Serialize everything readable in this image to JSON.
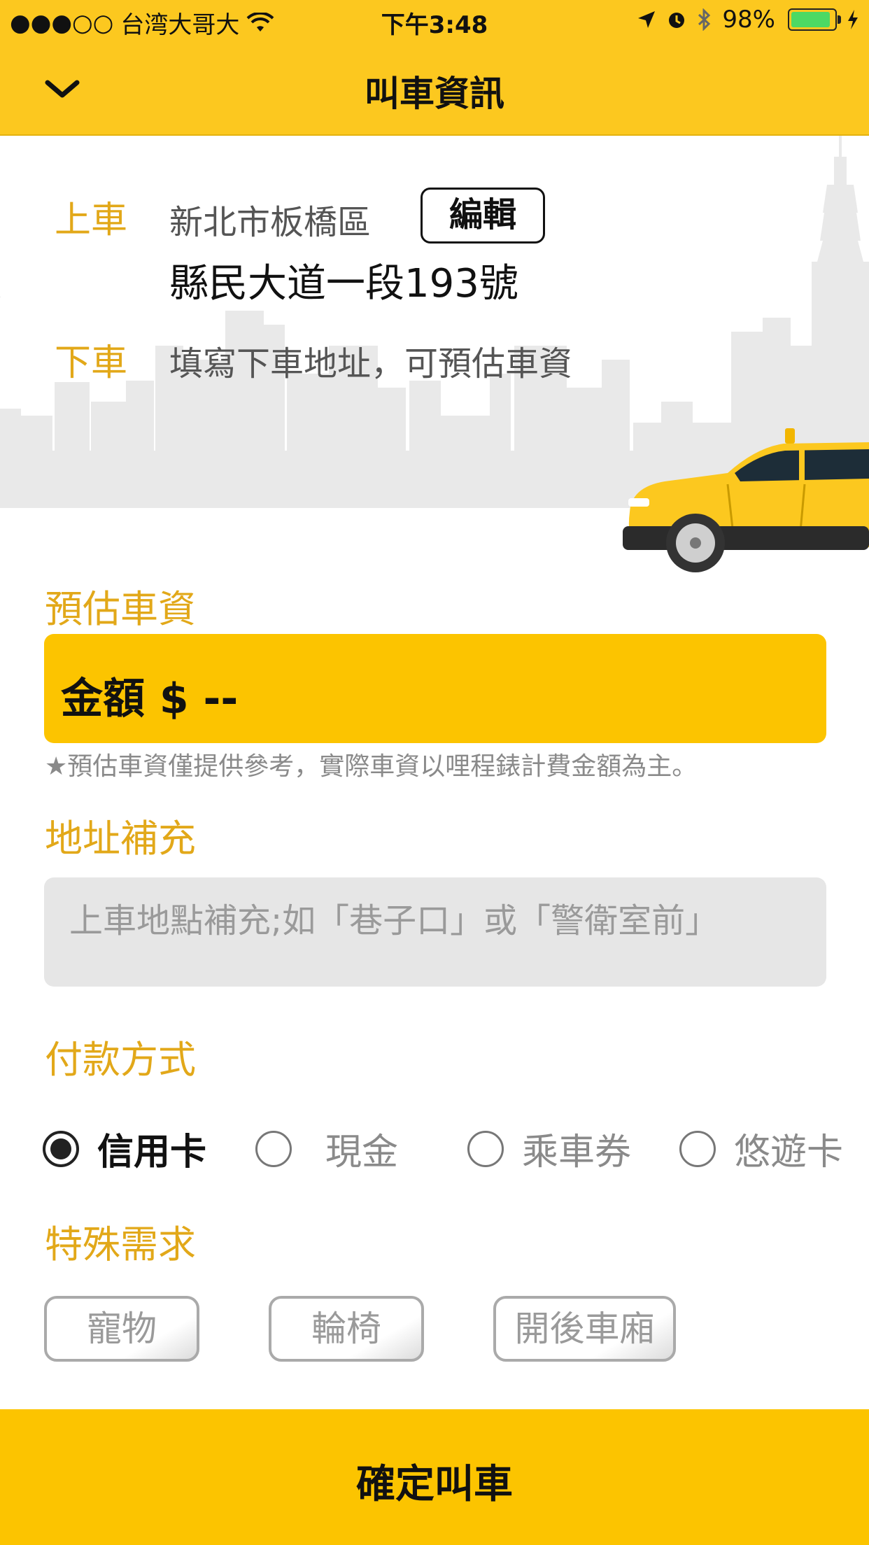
{
  "status_bar": {
    "signal": "●●●○○",
    "carrier": "台湾大哥大",
    "time": "下午3:48",
    "battery_percent": "98%",
    "battery_level": 0.98
  },
  "header": {
    "title": "叫車資訊",
    "back_icon": "chevron-down-icon"
  },
  "route": {
    "pickup_label": "上車",
    "pickup_line1": "新北市板橋區",
    "pickup_line2": "縣民大道一段193號",
    "edit_label": "編輯",
    "dropoff_label": "下車",
    "dropoff_placeholder": "填寫下車地址，可預估車資"
  },
  "fare": {
    "title": "預估車資",
    "amount": "金額 $ --",
    "note": "★預估車資僅提供參考，實際車資以哩程錶計費金額為主。"
  },
  "address_supplement": {
    "title": "地址補充",
    "placeholder": "上車地點補充;如「巷子口」或「警衛室前」"
  },
  "payment": {
    "title": "付款方式",
    "options": [
      {
        "label": "信用卡",
        "selected": true
      },
      {
        "label": "現金",
        "selected": false
      },
      {
        "label": "乘車券",
        "selected": false
      },
      {
        "label": "悠遊卡",
        "selected": false
      }
    ]
  },
  "special": {
    "title": "特殊需求",
    "options": [
      "寵物",
      "輪椅",
      "開後車廂"
    ]
  },
  "confirm_label": "確定叫車",
  "colors": {
    "brand_yellow": "#FCC81F",
    "accent_text": "#E2A819",
    "fare_box": "#FCC400",
    "battery_green": "#4CD964"
  }
}
